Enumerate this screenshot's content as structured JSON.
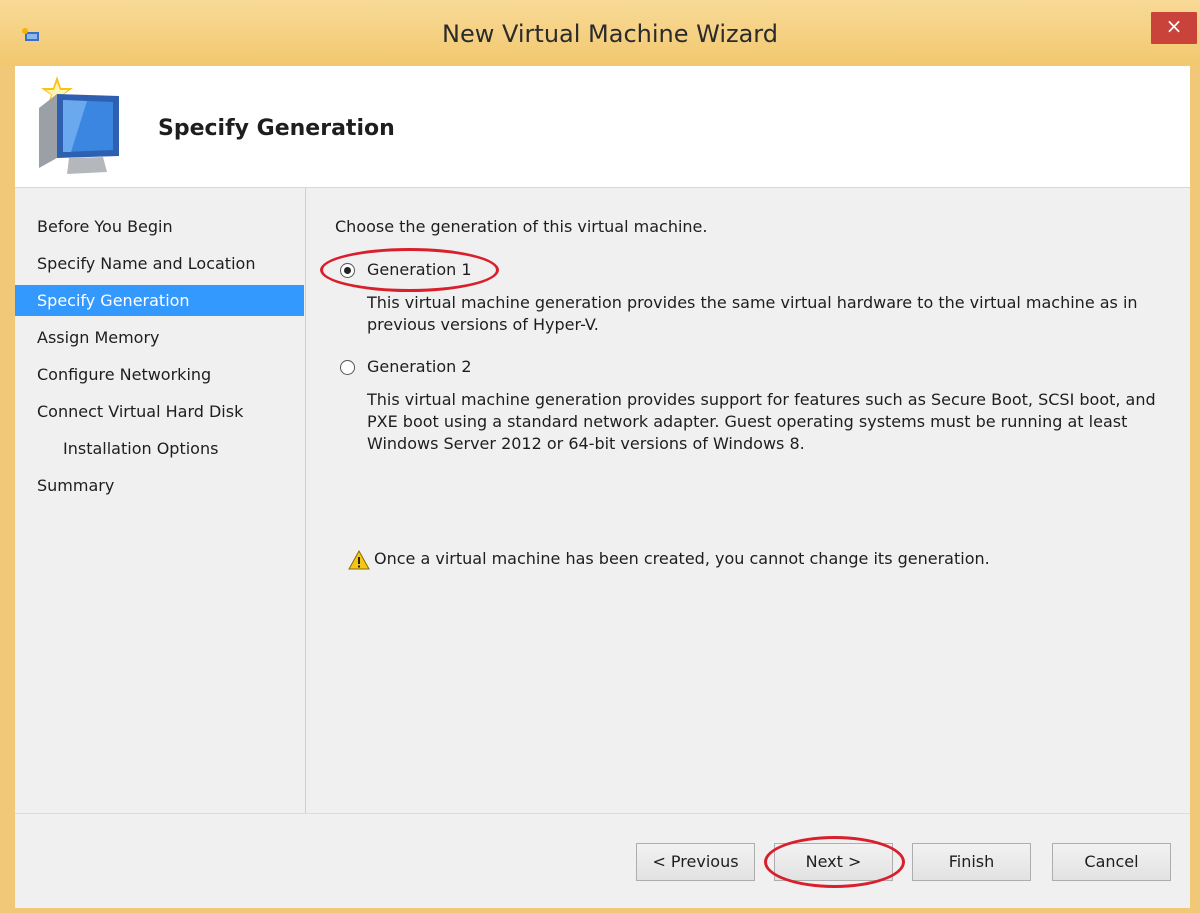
{
  "window": {
    "title": "New Virtual Machine Wizard",
    "close_glyph": "×"
  },
  "header": {
    "title": "Specify Generation",
    "icon": "monitor-star-icon"
  },
  "nav": {
    "items": [
      {
        "label": "Before You Begin"
      },
      {
        "label": "Specify Name and Location"
      },
      {
        "label": "Specify Generation",
        "selected": true
      },
      {
        "label": "Assign Memory"
      },
      {
        "label": "Configure Networking"
      },
      {
        "label": "Connect Virtual Hard Disk"
      },
      {
        "label": "Installation Options",
        "indented": true
      },
      {
        "label": "Summary"
      }
    ]
  },
  "content": {
    "prompt": "Choose the generation of this virtual machine.",
    "gen1": {
      "label": "Generation 1",
      "selected": true,
      "desc_line1": "This virtual machine generation provides the same virtual hardware to the virtual machine as in",
      "desc_line2": "previous versions of Hyper-V."
    },
    "gen2": {
      "label": "Generation 2",
      "selected": false,
      "desc_line1": "This virtual machine generation provides support for features such as Secure Boot, SCSI boot, and",
      "desc_line2": "PXE boot using a standard network adapter. Guest operating systems must be running at least",
      "desc_line3": "Windows Server 2012 or 64-bit versions of Windows 8."
    },
    "warning": "Once a virtual machine has been created, you cannot change its generation."
  },
  "buttons": {
    "previous": "< Previous",
    "next": "Next >",
    "finish": "Finish",
    "cancel": "Cancel"
  },
  "colors": {
    "accent": "#3399ff",
    "annotation": "#d81f2b",
    "frame": "#f0c877"
  }
}
